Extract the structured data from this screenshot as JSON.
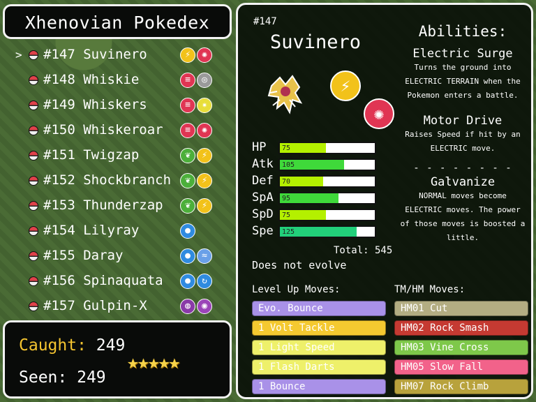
{
  "title": "Xhenovian Pokedex",
  "list": [
    {
      "num": "#147",
      "name": "Suvinero",
      "selected": true,
      "types": [
        {
          "icon": "electric-type-icon",
          "glyph": "⚡",
          "color": "#f2c21a"
        },
        {
          "icon": "flying-bird-type-icon",
          "glyph": "✺",
          "color": "#e03553"
        }
      ]
    },
    {
      "num": "#148",
      "name": "Whiskie",
      "selected": false,
      "types": [
        {
          "icon": "claw-type-icon",
          "glyph": "≡",
          "color": "#e03553"
        },
        {
          "icon": "ring-type-icon",
          "glyph": "◎",
          "color": "#9a9a9a"
        }
      ]
    },
    {
      "num": "#149",
      "name": "Whiskers",
      "selected": false,
      "types": [
        {
          "icon": "claw-type-icon",
          "glyph": "≡",
          "color": "#e03553"
        },
        {
          "icon": "light-type-icon",
          "glyph": "✷",
          "color": "#e8de3a"
        }
      ]
    },
    {
      "num": "#150",
      "name": "Whiskeroar",
      "selected": false,
      "types": [
        {
          "icon": "claw-type-icon",
          "glyph": "≡",
          "color": "#e03553"
        },
        {
          "icon": "flying-bird-type-icon",
          "glyph": "✺",
          "color": "#e03553"
        }
      ]
    },
    {
      "num": "#151",
      "name": "Twigzap",
      "selected": false,
      "types": [
        {
          "icon": "grass-leaf-type-icon",
          "glyph": "❦",
          "color": "#4caf3a"
        },
        {
          "icon": "electric-type-icon",
          "glyph": "⚡",
          "color": "#f2c21a"
        }
      ]
    },
    {
      "num": "#152",
      "name": "Shockbranch",
      "selected": false,
      "types": [
        {
          "icon": "grass-leaf-type-icon",
          "glyph": "❦",
          "color": "#4caf3a"
        },
        {
          "icon": "electric-type-icon",
          "glyph": "⚡",
          "color": "#f2c21a"
        }
      ]
    },
    {
      "num": "#153",
      "name": "Thunderzap",
      "selected": false,
      "types": [
        {
          "icon": "grass-leaf-type-icon",
          "glyph": "❦",
          "color": "#4caf3a"
        },
        {
          "icon": "electric-type-icon",
          "glyph": "⚡",
          "color": "#f2c21a"
        }
      ]
    },
    {
      "num": "#154",
      "name": "Lilyray",
      "selected": false,
      "types": [
        {
          "icon": "water-drop-type-icon",
          "glyph": "●",
          "color": "#2f8be0"
        }
      ]
    },
    {
      "num": "#155",
      "name": "Daray",
      "selected": false,
      "types": [
        {
          "icon": "water-drop-type-icon",
          "glyph": "●",
          "color": "#2f8be0"
        },
        {
          "icon": "wind-type-icon",
          "glyph": "≈",
          "color": "#6aa0e8"
        }
      ]
    },
    {
      "num": "#156",
      "name": "Spinaquata",
      "selected": false,
      "types": [
        {
          "icon": "water-drop-type-icon",
          "glyph": "●",
          "color": "#2f8be0"
        },
        {
          "icon": "swirl-type-icon",
          "glyph": "↻",
          "color": "#2f8be0"
        }
      ]
    },
    {
      "num": "#157",
      "name": "Gulpin-X",
      "selected": false,
      "types": [
        {
          "icon": "planet-type-icon",
          "glyph": "◍",
          "color": "#8a3aa8"
        },
        {
          "icon": "poison-type-icon",
          "glyph": "◉",
          "color": "#9b45b8"
        }
      ]
    }
  ],
  "counts": {
    "caught_label": "Caught:",
    "caught_value": "249",
    "seen_label": "Seen:",
    "seen_value": "249",
    "stars": "★★★★★"
  },
  "detail": {
    "dexnum": "#147",
    "name": "Suvinero",
    "type1": {
      "icon": "electric-type-icon",
      "glyph": "⚡",
      "color": "#f2c21a"
    },
    "type2": {
      "icon": "flying-bird-type-icon",
      "glyph": "✺",
      "color": "#e03553"
    },
    "abilities_header": "Abilities:",
    "abilities": [
      {
        "name": "Electric Surge",
        "desc": "Turns the ground into ELECTRIC TERRAIN when the Pokemon enters a battle."
      },
      {
        "name": "Motor Drive",
        "desc": "Raises Speed if hit by an ELECTRIC move."
      },
      {
        "name": "Galvanize",
        "desc": "NORMAL moves become ELECTRIC moves. The power of those moves is boosted a little."
      }
    ],
    "separator": "- - - - - - - - - - -",
    "stats": [
      {
        "label": "HP",
        "value": 75,
        "text": "75",
        "color": "#b4f000"
      },
      {
        "label": "Atk",
        "value": 105,
        "text": "105",
        "color": "#3fd93a"
      },
      {
        "label": "Def",
        "value": 70,
        "text": "70",
        "color": "#b4f000"
      },
      {
        "label": "SpA",
        "value": 95,
        "text": "95",
        "color": "#3fd93a"
      },
      {
        "label": "SpD",
        "value": 75,
        "text": "75",
        "color": "#b4f000"
      },
      {
        "label": "Spe",
        "value": 125,
        "text": "125",
        "color": "#22d07a"
      }
    ],
    "total": "Total: 545",
    "evolution": "Does not evolve",
    "levelup_header": "Level Up Moves:",
    "tm_header": "TM/HM Moves:",
    "levelup": [
      {
        "name": "Evo. Bounce",
        "color": "#a991e8"
      },
      {
        "name": "1 Volt Tackle",
        "color": "#f4c930"
      },
      {
        "name": "1 Light Speed",
        "color": "#eef06a"
      },
      {
        "name": "1 Flash Darts",
        "color": "#eef06a"
      },
      {
        "name": "1 Bounce",
        "color": "#a991e8"
      }
    ],
    "tm": [
      {
        "name": "HM01 Cut",
        "color": "#b3ad82"
      },
      {
        "name": "HM02 Rock Smash",
        "color": "#c53a32"
      },
      {
        "name": "HM03 Vine Cross",
        "color": "#7ec84a"
      },
      {
        "name": "HM05 Slow Fall",
        "color": "#f2628a"
      },
      {
        "name": "HM07 Rock Climb",
        "color": "#b8a23c"
      }
    ]
  }
}
